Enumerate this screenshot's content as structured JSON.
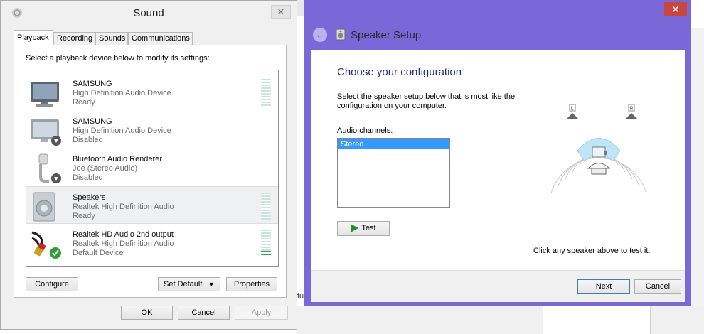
{
  "sound_dialog": {
    "title": "Sound",
    "tabs": [
      "Playback",
      "Recording",
      "Sounds",
      "Communications"
    ],
    "instruction": "Select a playback device below to modify its settings:",
    "devices": [
      {
        "name": "SAMSUNG",
        "description": "High Definition Audio Device",
        "state": "Ready",
        "icon": "tv-icon",
        "level": 0
      },
      {
        "name": "SAMSUNG",
        "description": "High Definition Audio Device",
        "state": "Disabled",
        "icon": "tv-disabled-icon",
        "level": null
      },
      {
        "name": "Bluetooth Audio Renderer",
        "description": "Joe (Stereo Audio)",
        "state": "Disabled",
        "icon": "headset-disabled-icon",
        "level": null
      },
      {
        "name": "Speakers",
        "description": "Realtek High Definition Audio",
        "state": "Ready",
        "icon": "speaker-icon",
        "level": 0
      },
      {
        "name": "Realtek HD Audio 2nd output",
        "description": "Realtek High Definition Audio",
        "state": "Default Device",
        "icon": "rca-cable-default-icon",
        "level": 0.2
      }
    ],
    "buttons": {
      "configure": "Configure",
      "set_default": "Set Default",
      "properties": "Properties",
      "ok": "OK",
      "cancel": "Cancel",
      "apply": "Apply"
    }
  },
  "speaker_setup": {
    "title": "Speaker Setup",
    "heading": "Choose your configuration",
    "description": "Select the speaker setup below that is most like the configuration on your computer.",
    "channels_label": "Audio channels:",
    "channels": [
      "Stereo"
    ],
    "selected_channel": "Stereo",
    "test_label": "Test",
    "hint": "Click any speaker above to test it.",
    "speaker_labels": {
      "left": "L",
      "right": "R"
    },
    "buttons": {
      "next": "Next",
      "cancel": "Cancel"
    },
    "accent_color": "#7b68d8",
    "close_color": "#c7473d"
  },
  "background": {
    "partial_text": "tu"
  }
}
